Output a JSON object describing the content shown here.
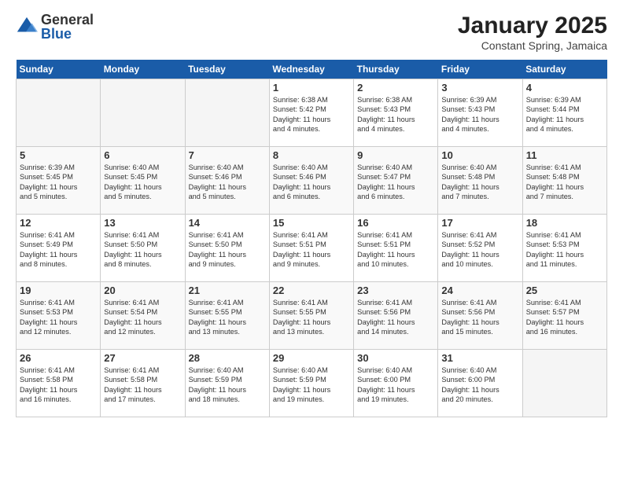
{
  "logo": {
    "general": "General",
    "blue": "Blue"
  },
  "title": "January 2025",
  "location": "Constant Spring, Jamaica",
  "days_of_week": [
    "Sunday",
    "Monday",
    "Tuesday",
    "Wednesday",
    "Thursday",
    "Friday",
    "Saturday"
  ],
  "weeks": [
    [
      {
        "num": "",
        "info": ""
      },
      {
        "num": "",
        "info": ""
      },
      {
        "num": "",
        "info": ""
      },
      {
        "num": "1",
        "info": "Sunrise: 6:38 AM\nSunset: 5:42 PM\nDaylight: 11 hours\nand 4 minutes."
      },
      {
        "num": "2",
        "info": "Sunrise: 6:38 AM\nSunset: 5:43 PM\nDaylight: 11 hours\nand 4 minutes."
      },
      {
        "num": "3",
        "info": "Sunrise: 6:39 AM\nSunset: 5:43 PM\nDaylight: 11 hours\nand 4 minutes."
      },
      {
        "num": "4",
        "info": "Sunrise: 6:39 AM\nSunset: 5:44 PM\nDaylight: 11 hours\nand 4 minutes."
      }
    ],
    [
      {
        "num": "5",
        "info": "Sunrise: 6:39 AM\nSunset: 5:45 PM\nDaylight: 11 hours\nand 5 minutes."
      },
      {
        "num": "6",
        "info": "Sunrise: 6:40 AM\nSunset: 5:45 PM\nDaylight: 11 hours\nand 5 minutes."
      },
      {
        "num": "7",
        "info": "Sunrise: 6:40 AM\nSunset: 5:46 PM\nDaylight: 11 hours\nand 5 minutes."
      },
      {
        "num": "8",
        "info": "Sunrise: 6:40 AM\nSunset: 5:46 PM\nDaylight: 11 hours\nand 6 minutes."
      },
      {
        "num": "9",
        "info": "Sunrise: 6:40 AM\nSunset: 5:47 PM\nDaylight: 11 hours\nand 6 minutes."
      },
      {
        "num": "10",
        "info": "Sunrise: 6:40 AM\nSunset: 5:48 PM\nDaylight: 11 hours\nand 7 minutes."
      },
      {
        "num": "11",
        "info": "Sunrise: 6:41 AM\nSunset: 5:48 PM\nDaylight: 11 hours\nand 7 minutes."
      }
    ],
    [
      {
        "num": "12",
        "info": "Sunrise: 6:41 AM\nSunset: 5:49 PM\nDaylight: 11 hours\nand 8 minutes."
      },
      {
        "num": "13",
        "info": "Sunrise: 6:41 AM\nSunset: 5:50 PM\nDaylight: 11 hours\nand 8 minutes."
      },
      {
        "num": "14",
        "info": "Sunrise: 6:41 AM\nSunset: 5:50 PM\nDaylight: 11 hours\nand 9 minutes."
      },
      {
        "num": "15",
        "info": "Sunrise: 6:41 AM\nSunset: 5:51 PM\nDaylight: 11 hours\nand 9 minutes."
      },
      {
        "num": "16",
        "info": "Sunrise: 6:41 AM\nSunset: 5:51 PM\nDaylight: 11 hours\nand 10 minutes."
      },
      {
        "num": "17",
        "info": "Sunrise: 6:41 AM\nSunset: 5:52 PM\nDaylight: 11 hours\nand 10 minutes."
      },
      {
        "num": "18",
        "info": "Sunrise: 6:41 AM\nSunset: 5:53 PM\nDaylight: 11 hours\nand 11 minutes."
      }
    ],
    [
      {
        "num": "19",
        "info": "Sunrise: 6:41 AM\nSunset: 5:53 PM\nDaylight: 11 hours\nand 12 minutes."
      },
      {
        "num": "20",
        "info": "Sunrise: 6:41 AM\nSunset: 5:54 PM\nDaylight: 11 hours\nand 12 minutes."
      },
      {
        "num": "21",
        "info": "Sunrise: 6:41 AM\nSunset: 5:55 PM\nDaylight: 11 hours\nand 13 minutes."
      },
      {
        "num": "22",
        "info": "Sunrise: 6:41 AM\nSunset: 5:55 PM\nDaylight: 11 hours\nand 13 minutes."
      },
      {
        "num": "23",
        "info": "Sunrise: 6:41 AM\nSunset: 5:56 PM\nDaylight: 11 hours\nand 14 minutes."
      },
      {
        "num": "24",
        "info": "Sunrise: 6:41 AM\nSunset: 5:56 PM\nDaylight: 11 hours\nand 15 minutes."
      },
      {
        "num": "25",
        "info": "Sunrise: 6:41 AM\nSunset: 5:57 PM\nDaylight: 11 hours\nand 16 minutes."
      }
    ],
    [
      {
        "num": "26",
        "info": "Sunrise: 6:41 AM\nSunset: 5:58 PM\nDaylight: 11 hours\nand 16 minutes."
      },
      {
        "num": "27",
        "info": "Sunrise: 6:41 AM\nSunset: 5:58 PM\nDaylight: 11 hours\nand 17 minutes."
      },
      {
        "num": "28",
        "info": "Sunrise: 6:40 AM\nSunset: 5:59 PM\nDaylight: 11 hours\nand 18 minutes."
      },
      {
        "num": "29",
        "info": "Sunrise: 6:40 AM\nSunset: 5:59 PM\nDaylight: 11 hours\nand 19 minutes."
      },
      {
        "num": "30",
        "info": "Sunrise: 6:40 AM\nSunset: 6:00 PM\nDaylight: 11 hours\nand 19 minutes."
      },
      {
        "num": "31",
        "info": "Sunrise: 6:40 AM\nSunset: 6:00 PM\nDaylight: 11 hours\nand 20 minutes."
      },
      {
        "num": "",
        "info": ""
      }
    ]
  ]
}
